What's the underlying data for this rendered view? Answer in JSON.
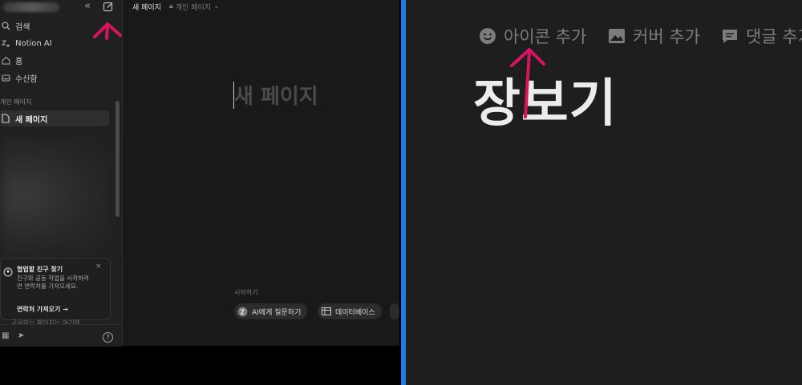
{
  "sidebar": {
    "items": [
      {
        "label": "검색",
        "icon": "search-icon"
      },
      {
        "label": "Notion AI",
        "icon": "notion-ai-icon"
      },
      {
        "label": "홈",
        "icon": "home-icon"
      },
      {
        "label": "수신함",
        "icon": "inbox-icon"
      }
    ],
    "section_label": "개인 페이지",
    "page": "새 페이지",
    "card": {
      "title": "협업할 친구 찾기",
      "body": "친구와 공동 작업을 시작하려면 연락처를 가져오세요.",
      "link": "연락처 가져오기",
      "close": "×"
    },
    "under_text": "공유하는 페이지는 여기에",
    "help": "?"
  },
  "topbar": {
    "title": "새 페이지",
    "location": "개인 페이지"
  },
  "editor": {
    "title_placeholder": "새 페이지",
    "start_label": "시작하기",
    "actions": [
      {
        "label": "AI에게 질문하기",
        "icon": "notion-ai-icon"
      },
      {
        "label": "데이터베이스",
        "icon": "table-icon"
      }
    ]
  },
  "zoom": {
    "buttons": [
      {
        "label": "아이콘 추가",
        "icon": "smiley-icon"
      },
      {
        "label": "커버 추가",
        "icon": "image-icon"
      },
      {
        "label": "댓글 추가",
        "icon": "comment-icon"
      }
    ],
    "title": "장보기"
  },
  "colors": {
    "annotation": "#d6145f",
    "highlight": "#1f7fe0",
    "background": "#191919"
  }
}
